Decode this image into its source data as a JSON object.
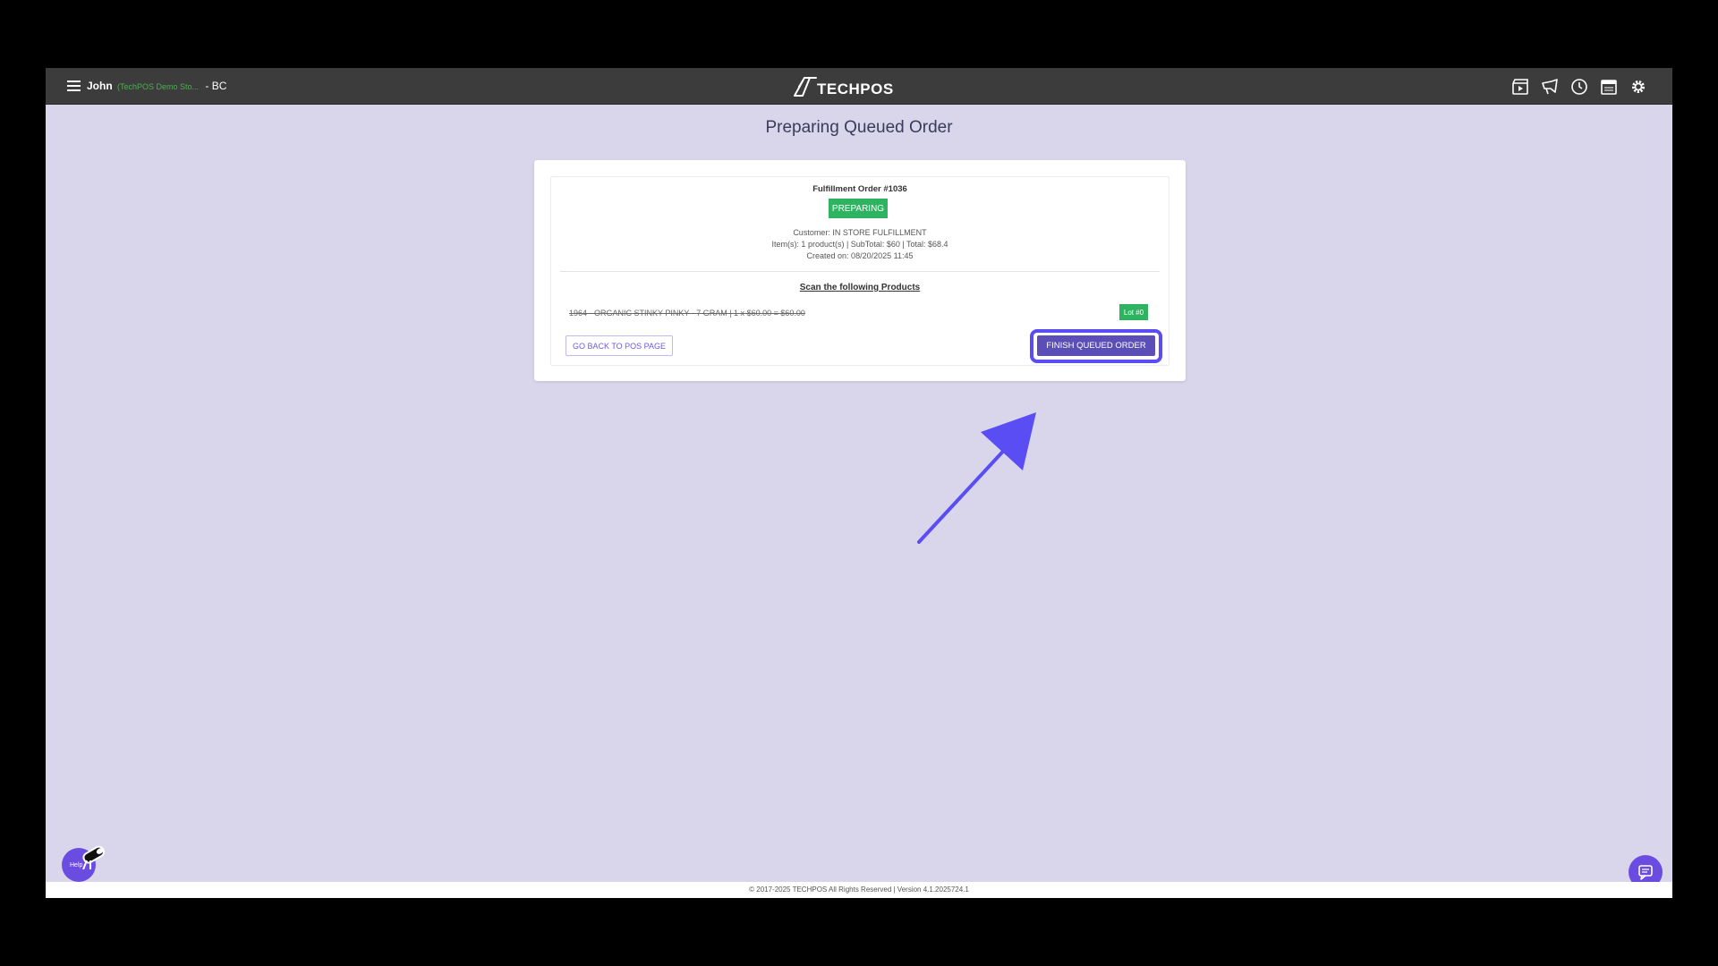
{
  "header": {
    "user_name": "John",
    "store_name": "(TechPOS Demo Sto...",
    "region": "- BC",
    "logo_text": "TECHPOS",
    "icons": [
      "film-icon",
      "megaphone-icon",
      "clock-icon",
      "calendar-icon",
      "gear-icon"
    ]
  },
  "page": {
    "title": "Preparing Queued Order"
  },
  "order": {
    "title": "Fulfillment Order #1036",
    "status": "PREPARING",
    "customer": "Customer: IN STORE FULFILLMENT",
    "items_summary": "Item(s): 1 product(s) | SubTotal: $60 | Total: $68.4",
    "created": "Created on: 08/20/2025 11:45"
  },
  "scan": {
    "heading": "Scan the following Products",
    "products": [
      {
        "line": "1964 - ORGANIC STINKY PINKY - 7 GRAM | 1 x $60.00 = $60.00",
        "lot": "Lot #0"
      }
    ]
  },
  "actions": {
    "back_label": "GO BACK TO POS PAGE",
    "finish_label": "FINISH QUEUED ORDER"
  },
  "footer": {
    "text": "© 2017-2025 TECHPOS All Rights Reserved | Version 4.1.2025724.1"
  },
  "help": {
    "label": "Help"
  },
  "colors": {
    "accent": "#5b4eb6",
    "highlight": "#5a4df3",
    "success": "#2eb460",
    "background": "#d9d6ec",
    "topbar": "#3c3c3c"
  }
}
